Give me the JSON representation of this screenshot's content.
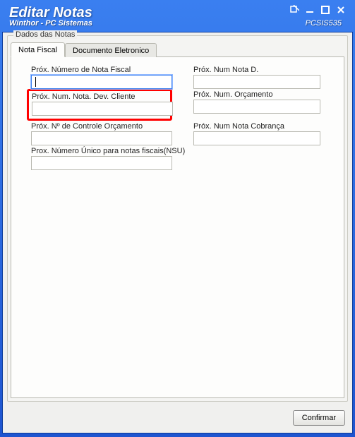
{
  "window": {
    "title": "Editar Notas",
    "subtitle": "Winthor - PC Sistemas",
    "code": "PCSIS535"
  },
  "groupbox": {
    "legend": "Dados das Notas"
  },
  "tabs": {
    "fiscal": "Nota Fiscal",
    "eletronico": "Documento Eletronico"
  },
  "fields": {
    "prox_num_nota_fiscal": {
      "label": "Próx. Número de Nota Fiscal",
      "value": ""
    },
    "prox_num_nota_d": {
      "label": "Próx. Num Nota D.",
      "value": ""
    },
    "prox_num_nota_dev_cliente": {
      "label": "Próx. Num. Nota. Dev. Cliente",
      "value": ""
    },
    "prox_num_orcamento": {
      "label": "Próx. Num. Orçamento",
      "value": ""
    },
    "prox_num_controle_orcamento": {
      "label": "Próx. Nº de Controle Orçamento",
      "value": ""
    },
    "prox_num_nota_cobranca": {
      "label": "Próx. Num Nota Cobrança",
      "value": ""
    },
    "prox_nsu": {
      "label": "Prox. Número Único para notas fiscais(NSU)",
      "value": ""
    }
  },
  "buttons": {
    "confirm": "Confirmar"
  }
}
